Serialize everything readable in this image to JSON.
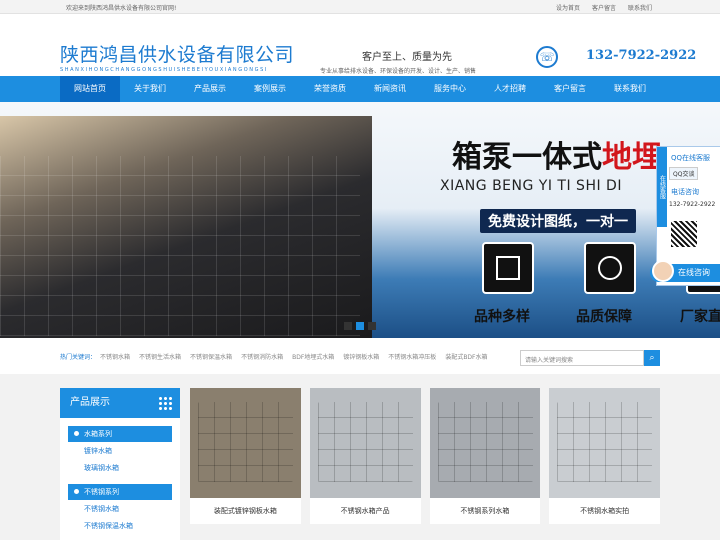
{
  "topbar": {
    "welcome": "欢迎来到陕西鸿昌供水设备有限公司官网!",
    "links": [
      "设为首页",
      "客户留言",
      "联系我们"
    ]
  },
  "header": {
    "logo_cn": "陕西鸿昌供水设备有限公司",
    "logo_en": "SHANXIHONGCHANGGONGSHUISHEBEIYOUXIANGONGSI",
    "slogan": "客户至上、质量为先",
    "subslogan": "专业从事给排水设备、环保设备的开发、设计、生产、销售",
    "phone": "132-7922-2922"
  },
  "nav": {
    "items": [
      "网站首页",
      "关于我们",
      "产品展示",
      "案例展示",
      "荣誉资质",
      "新闻资讯",
      "服务中心",
      "人才招聘",
      "客户留言",
      "联系我们"
    ],
    "active_index": 0
  },
  "banner": {
    "title_black": "箱泵一体式",
    "title_red": "地埋",
    "pinyin": "XIANG BENG YI TI SHI DI",
    "free_design": "免费设计图纸，一对一",
    "features": [
      "品种多样",
      "品质保障",
      "厂家直"
    ],
    "active_dot": 1
  },
  "float_panel": {
    "tab": "在线客服",
    "qq_title": "QQ在线客服",
    "qq_button": "QQ交谈",
    "tel_title": "电话咨询",
    "tel": "132-7922-2922",
    "online": "在线咨询"
  },
  "keywords": {
    "label": "热门关键词：",
    "items": [
      "不锈钢水箱",
      "不锈钢生活水箱",
      "不锈钢保温水箱",
      "不锈钢消防水箱",
      "BDF地埋式水箱",
      "镀锌钢板水箱",
      "不锈钢水箱冲压板",
      "装配式BDF水箱"
    ]
  },
  "search": {
    "placeholder": "请输入关键词搜索"
  },
  "sidebar": {
    "title": "产品展示",
    "categories": [
      {
        "label": "水箱系列",
        "subs": [
          "镀锌水箱",
          "玻璃钢水箱"
        ]
      },
      {
        "label": "不锈钢系列",
        "subs": [
          "不锈钢水箱",
          "不锈钢保温水箱"
        ]
      }
    ]
  },
  "products": [
    {
      "name": "装配式镀锌钢板水箱",
      "color": "#8a7f6e"
    },
    {
      "name": "不锈钢水箱产品",
      "color": "#b9bdc1"
    },
    {
      "name": "不锈钢系列水箱",
      "color": "#a7abb0"
    },
    {
      "name": "不锈钢水箱实拍",
      "color": "#c9cdd1"
    }
  ]
}
